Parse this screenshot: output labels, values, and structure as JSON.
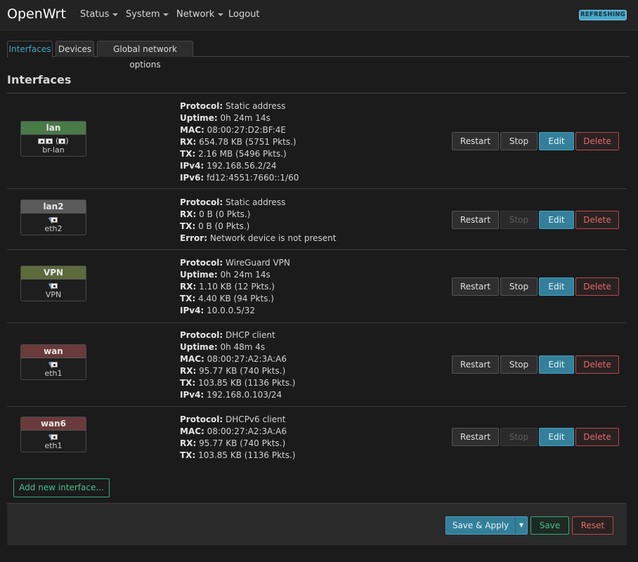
{
  "header": {
    "brand": "OpenWrt",
    "menu": [
      {
        "label": "Status"
      },
      {
        "label": "System"
      },
      {
        "label": "Network"
      },
      {
        "label": "Logout"
      }
    ],
    "status_badge": "REFRESHING"
  },
  "tabs": [
    {
      "label": "Interfaces",
      "active": true
    },
    {
      "label": "Devices",
      "active": false
    },
    {
      "label": "Global network options",
      "active": false
    }
  ],
  "section_title": "Interfaces",
  "buttons": {
    "restart": "Restart",
    "stop": "Stop",
    "edit": "Edit",
    "delete": "Delete"
  },
  "interfaces": [
    {
      "name": "lan",
      "color": "#4a7a48",
      "icons": "bridge",
      "device": "br-lan",
      "stop_enabled": true,
      "details": [
        {
          "k": "Protocol:",
          "v": "Static address"
        },
        {
          "k": "Uptime:",
          "v": "0h 24m 14s"
        },
        {
          "k": "MAC:",
          "v": "08:00:27:D2:BF:4E"
        },
        {
          "k": "RX:",
          "v": "654.78 KB (5751 Pkts.)"
        },
        {
          "k": "TX:",
          "v": "2.16 MB (5496 Pkts.)"
        },
        {
          "k": "IPv4:",
          "v": "192.168.56.2/24"
        },
        {
          "k": "IPv6:",
          "v": "fd12:4551:7660::1/60"
        }
      ]
    },
    {
      "name": "lan2",
      "color": "#5a5a5a",
      "icons": "single",
      "device": "eth2",
      "stop_enabled": false,
      "details": [
        {
          "k": "Protocol:",
          "v": "Static address"
        },
        {
          "k": "RX:",
          "v": "0 B (0 Pkts.)"
        },
        {
          "k": "TX:",
          "v": "0 B (0 Pkts.)"
        },
        {
          "k": "Error:",
          "v": "Network device is not present"
        }
      ]
    },
    {
      "name": "VPN",
      "color": "#5d6a3c",
      "icons": "single",
      "device": "VPN",
      "stop_enabled": true,
      "details": [
        {
          "k": "Protocol:",
          "v": "WireGuard VPN"
        },
        {
          "k": "Uptime:",
          "v": "0h 24m 14s"
        },
        {
          "k": "RX:",
          "v": "1.10 KB (12 Pkts.)"
        },
        {
          "k": "TX:",
          "v": "4.40 KB (94 Pkts.)"
        },
        {
          "k": "IPv4:",
          "v": "10.0.0.5/32"
        }
      ]
    },
    {
      "name": "wan",
      "color": "#6b3a3a",
      "icons": "single",
      "device": "eth1",
      "stop_enabled": true,
      "details": [
        {
          "k": "Protocol:",
          "v": "DHCP client"
        },
        {
          "k": "Uptime:",
          "v": "0h 48m 4s"
        },
        {
          "k": "MAC:",
          "v": "08:00:27:A2:3A:A6"
        },
        {
          "k": "RX:",
          "v": "95.77 KB (740 Pkts.)"
        },
        {
          "k": "TX:",
          "v": "103.85 KB (1136 Pkts.)"
        },
        {
          "k": "IPv4:",
          "v": "192.168.0.103/24"
        }
      ]
    },
    {
      "name": "wan6",
      "color": "#6b3a3a",
      "icons": "single",
      "device": "eth1",
      "stop_enabled": false,
      "details": [
        {
          "k": "Protocol:",
          "v": "DHCPv6 client"
        },
        {
          "k": "MAC:",
          "v": "08:00:27:A2:3A:A6"
        },
        {
          "k": "RX:",
          "v": "95.77 KB (740 Pkts.)"
        },
        {
          "k": "TX:",
          "v": "103.85 KB (1136 Pkts.)"
        }
      ]
    }
  ],
  "add_button": "Add new interface...",
  "footer": {
    "save_apply": "Save & Apply",
    "save": "Save",
    "reset": "Reset"
  }
}
